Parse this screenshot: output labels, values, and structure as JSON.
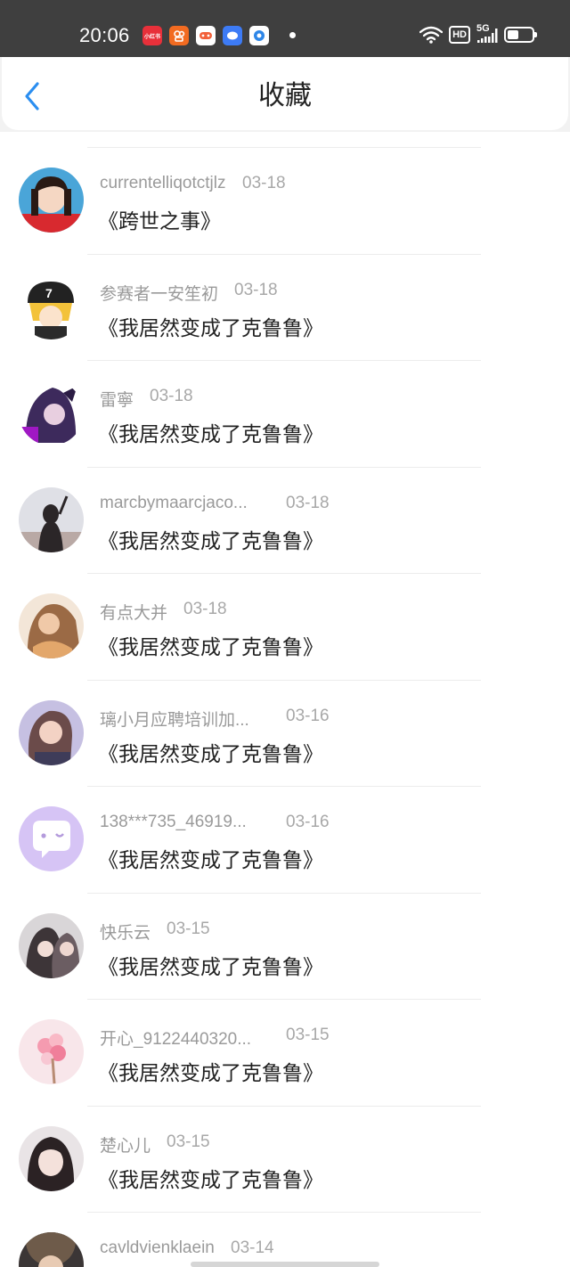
{
  "status_bar": {
    "time": "20:06",
    "network": "5G",
    "hd": "HD",
    "battery_level": 0.45,
    "notification_icons": [
      {
        "name": "xiaohongshu-icon",
        "label": "小红书",
        "color": "#e8303a"
      },
      {
        "name": "kuaishou-icon",
        "label": "",
        "color": "#f26b21"
      },
      {
        "name": "game-icon",
        "label": "",
        "color": "#ffffff"
      },
      {
        "name": "message-app-icon",
        "label": "",
        "color": "#3d7bf5"
      },
      {
        "name": "camera-app-icon",
        "label": "",
        "color": "#ffffff"
      }
    ]
  },
  "header": {
    "title": "收藏",
    "back_icon": "chevron-left-icon",
    "accent_color": "#2b8ef0"
  },
  "items": [
    {
      "user": "currentelliqotctjlz",
      "date": "03-18",
      "title": "《跨世之事》",
      "avatar": "girl-portrait"
    },
    {
      "user": "参赛者一安笙初",
      "date": "03-18",
      "title": "《我居然变成了克鲁鲁》",
      "avatar": "anime-boy-cap"
    },
    {
      "user": "雷寧",
      "date": "03-18",
      "title": "《我居然变成了克鲁鲁》",
      "avatar": "anime-purple-hair"
    },
    {
      "user": "marcbymaarcjaco...",
      "date": "03-18",
      "title": "《我居然变成了克鲁鲁》",
      "avatar": "silhouette-sky"
    },
    {
      "user": "有点大并",
      "date": "03-18",
      "title": "《我居然变成了克鲁鲁》",
      "avatar": "painted-woman"
    },
    {
      "user": "璃小月应聘培训加...",
      "date": "03-16",
      "title": "《我居然变成了克鲁鲁》",
      "avatar": "illustrated-girl"
    },
    {
      "user": "138***735_46919...",
      "date": "03-16",
      "title": "《我居然变成了克鲁鲁》",
      "avatar": "default-chat-bubble"
    },
    {
      "user": "快乐云",
      "date": "03-15",
      "title": "《我居然变成了克鲁鲁》",
      "avatar": "illustrated-couple"
    },
    {
      "user": "开心_9122440320...",
      "date": "03-15",
      "title": "《我居然变成了克鲁鲁》",
      "avatar": "pink-flowers"
    },
    {
      "user": "楚心儿",
      "date": "03-15",
      "title": "《我居然变成了克鲁鲁》",
      "avatar": "girl-bangs"
    },
    {
      "user": "cavldvienklaein",
      "date": "03-14",
      "title": "",
      "avatar": "dark-portrait"
    }
  ]
}
